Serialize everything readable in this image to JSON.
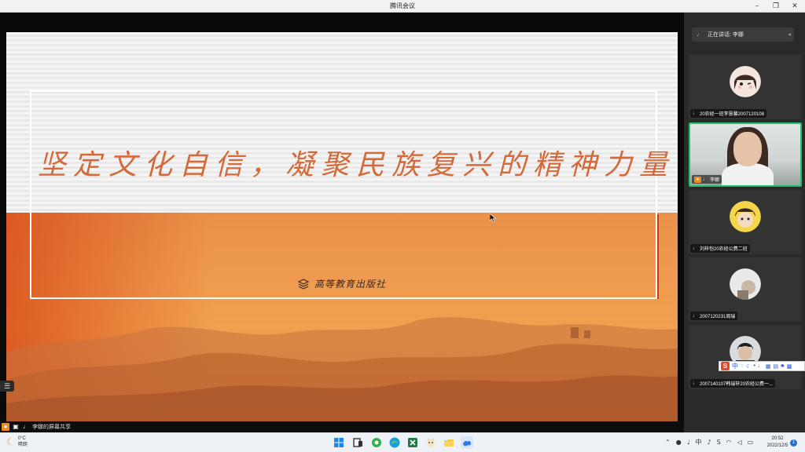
{
  "window": {
    "title": "腾讯会议",
    "minimize": "–",
    "restore": "❐",
    "close": "✕"
  },
  "slide": {
    "title": "坚定文化自信，凝聚民族复兴的精神力量",
    "publisher": "高等教育出版社"
  },
  "share_bar": {
    "text": "李娜的屏幕共享"
  },
  "sidebar": {
    "speaking_label": "正在讲话: 李娜",
    "participants": [
      {
        "name": "20农经一班李慧馨2007120108",
        "type": "avatar"
      },
      {
        "name": "李娜",
        "type": "video"
      },
      {
        "name": "刘梓恺20农经公费二班",
        "type": "avatar"
      },
      {
        "name": "2007120231周瑞",
        "type": "avatar"
      },
      {
        "name": "2007140107韩瑞轩20农经公费一...",
        "type": "avatar"
      }
    ]
  },
  "ime": {
    "logo": "S",
    "lang": "中"
  },
  "taskbar": {
    "weather_temp": "0°C",
    "weather_desc": "晴朗",
    "time": "20:52",
    "date": "2022/12/5",
    "notifications": "1",
    "tray_lang": "中"
  },
  "colors": {
    "accent": "#22c06a",
    "share_orange": "#f08a1c",
    "title_color": "#d46a3a"
  }
}
